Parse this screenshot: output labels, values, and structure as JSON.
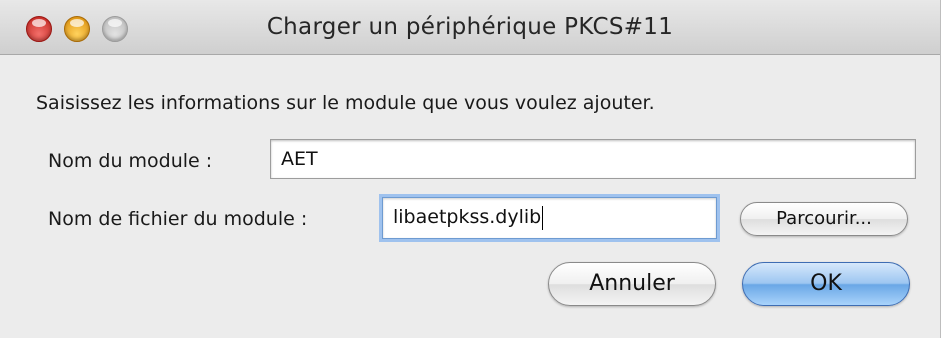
{
  "window": {
    "title": "Charger un périphérique PKCS#11"
  },
  "dialog": {
    "prompt": "Saisissez les informations sur le module que vous voulez ajouter.",
    "module_name_label": "Nom du module :",
    "module_name_value": "AET",
    "module_file_label": "Nom de fichier du module :",
    "module_file_value": "libaetpkss.dylib",
    "browse_label": "Parcourir...",
    "cancel_label": "Annuler",
    "ok_label": "OK"
  }
}
